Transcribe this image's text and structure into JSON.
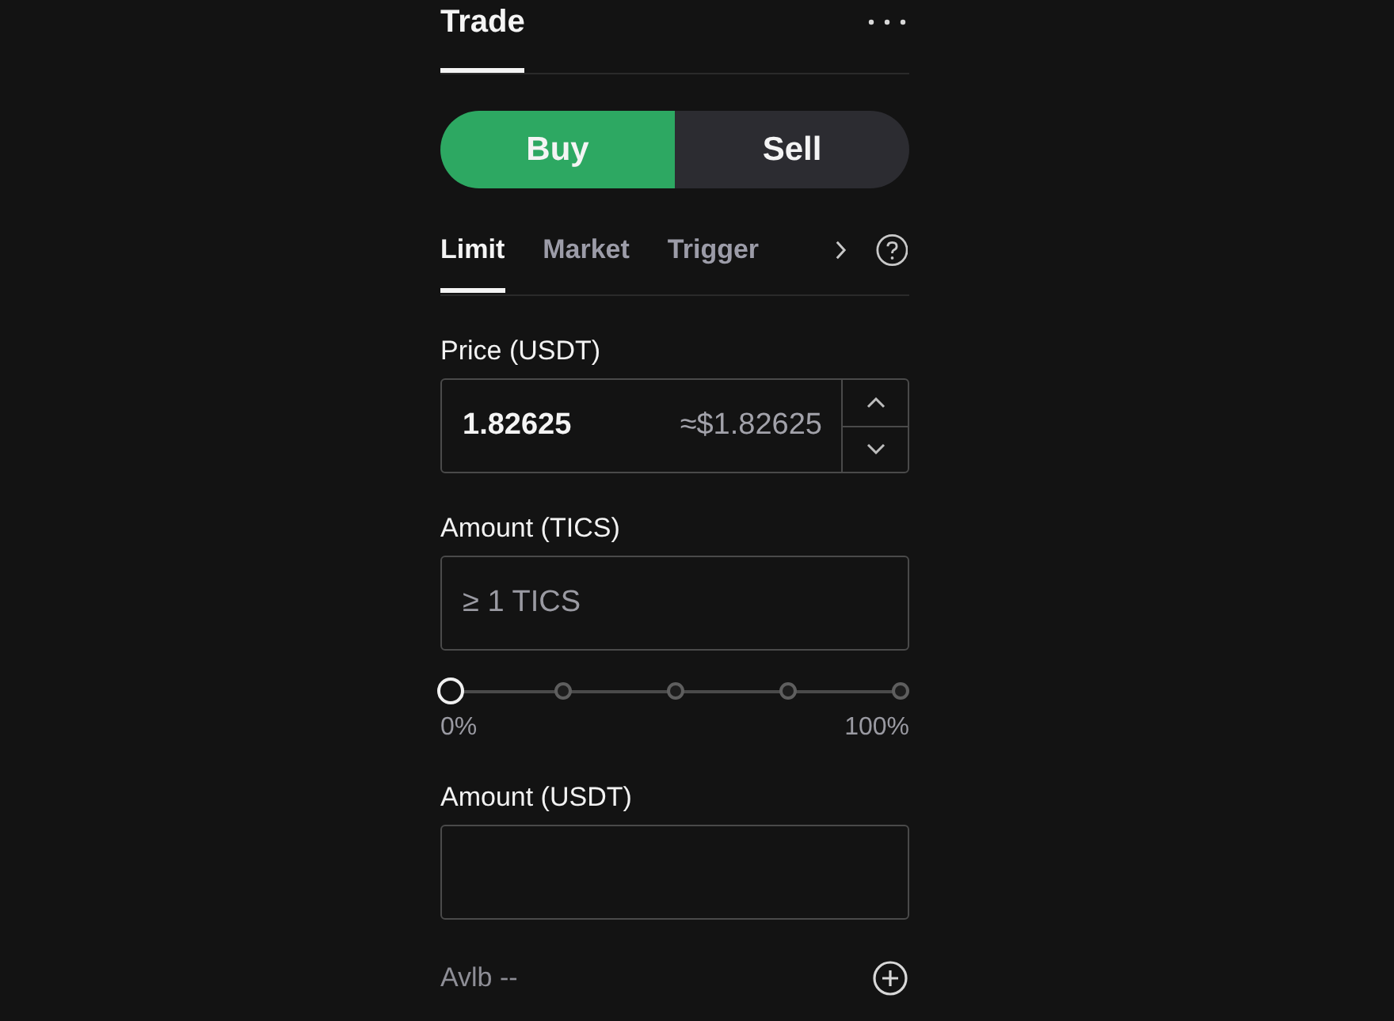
{
  "panel_tabs": [
    {
      "label": "Trade",
      "selected": true
    }
  ],
  "side_toggle": [
    {
      "label": "Buy",
      "selected": true
    },
    {
      "label": "Sell",
      "selected": false
    }
  ],
  "order_types": [
    {
      "label": "Limit",
      "selected": true
    },
    {
      "label": "Market",
      "selected": false
    },
    {
      "label": "Trigger",
      "selected": false
    }
  ],
  "form": [
    {
      "kind": "field",
      "label": "Price (USDT)",
      "value": "1.82625",
      "converted": "≈$1.82625",
      "stepper": true
    },
    {
      "kind": "field",
      "label": "Amount (TICS)",
      "placeholder": "≥ 1 TICS"
    },
    {
      "kind": "slider",
      "level": 0,
      "min_label": "0%",
      "max_label": "100%"
    },
    {
      "kind": "field",
      "label": "Amount (USDT)"
    }
  ],
  "available": "Avlb --"
}
